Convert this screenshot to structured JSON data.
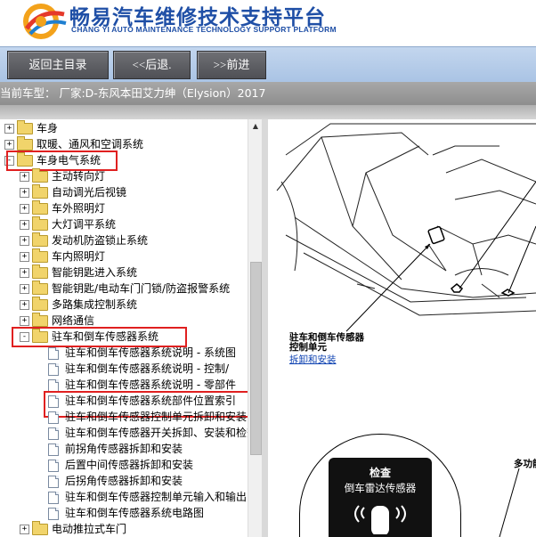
{
  "header": {
    "title_cn": "畅易汽车维修技术支持平台",
    "title_en": "CHANG YI AUTO MAINTENANCE TECHNOLOGY SUPPORT PLATFORM",
    "logo_icon": "chang-yi-logo-icon"
  },
  "toolbar": {
    "home_label": "返回主目录",
    "back_label": "<<后退.",
    "forward_label": ">>前进"
  },
  "car": {
    "text": "当前车型：  厂家:D-东风本田艾力绅（Elysion）2017"
  },
  "tree": {
    "items": [
      {
        "label": "车身",
        "type": "folder",
        "expander": "+",
        "level": 0
      },
      {
        "label": "取暖、通风和空调系统",
        "type": "folder",
        "expander": "+",
        "level": 0
      },
      {
        "label": "车身电气系统",
        "type": "folder-open",
        "expander": "-",
        "level": 0,
        "highlighted": true
      },
      {
        "label": "主动转向灯",
        "type": "folder",
        "expander": "+",
        "level": 1
      },
      {
        "label": "自动调光后视镜",
        "type": "folder",
        "expander": "+",
        "level": 1
      },
      {
        "label": "车外照明灯",
        "type": "folder",
        "expander": "+",
        "level": 1
      },
      {
        "label": "大灯调平系统",
        "type": "folder",
        "expander": "+",
        "level": 1
      },
      {
        "label": "发动机防盗锁止系统",
        "type": "folder",
        "expander": "+",
        "level": 1
      },
      {
        "label": "车内照明灯",
        "type": "folder",
        "expander": "+",
        "level": 1
      },
      {
        "label": "智能钥匙进入系统",
        "type": "folder",
        "expander": "+",
        "level": 1
      },
      {
        "label": "智能钥匙/电动车门门锁/防盗报警系统",
        "type": "folder",
        "expander": "+",
        "level": 1
      },
      {
        "label": "多路集成控制系统",
        "type": "folder",
        "expander": "+",
        "level": 1
      },
      {
        "label": "网络通信",
        "type": "folder",
        "expander": "+",
        "level": 1
      },
      {
        "label": "驻车和倒车传感器系统",
        "type": "folder-open",
        "expander": "-",
        "level": 1,
        "highlighted": true
      },
      {
        "label": "驻车和倒车传感器系统说明 - 系统图",
        "type": "doc",
        "level": 2
      },
      {
        "label": "驻车和倒车传感器系统说明 - 控制/",
        "type": "doc",
        "level": 2
      },
      {
        "label": "驻车和倒车传感器系统说明 - 零部件",
        "type": "doc",
        "level": 2
      },
      {
        "label": "驻车和倒车传感器系统部件位置索引",
        "type": "doc",
        "level": 2,
        "highlighted": true
      },
      {
        "label": "驻车和倒车传感器控制单元拆卸和安装",
        "type": "doc",
        "level": 2
      },
      {
        "label": "驻车和倒车传感器开关拆卸、安装和检查",
        "type": "doc",
        "level": 2
      },
      {
        "label": "前拐角传感器拆卸和安装",
        "type": "doc",
        "level": 2
      },
      {
        "label": "后置中间传感器拆卸和安装",
        "type": "doc",
        "level": 2
      },
      {
        "label": "后拐角传感器拆卸和安装",
        "type": "doc",
        "level": 2
      },
      {
        "label": "驻车和倒车传感器控制单元输入和输出",
        "type": "doc",
        "level": 2
      },
      {
        "label": "驻车和倒车传感器系统电路图",
        "type": "doc",
        "level": 2
      },
      {
        "label": "电动推拉式车门",
        "type": "folder",
        "expander": "+",
        "level": 1
      }
    ]
  },
  "diagram": {
    "control_unit_label_1": "驻车和倒车传感器",
    "control_unit_label_2": "控制单元",
    "link_label": "拆卸和安装",
    "multi_label": "多功能",
    "warning_title": "检查",
    "warning_text": "倒车雷达传感器"
  },
  "colors": {
    "brand_blue": "#1f4fa6",
    "highlight_red": "#e02020",
    "toolbar_blue": "#b6cce9",
    "button_gray": "#5e5f64",
    "carbar_gray": "#9b9b9b"
  }
}
